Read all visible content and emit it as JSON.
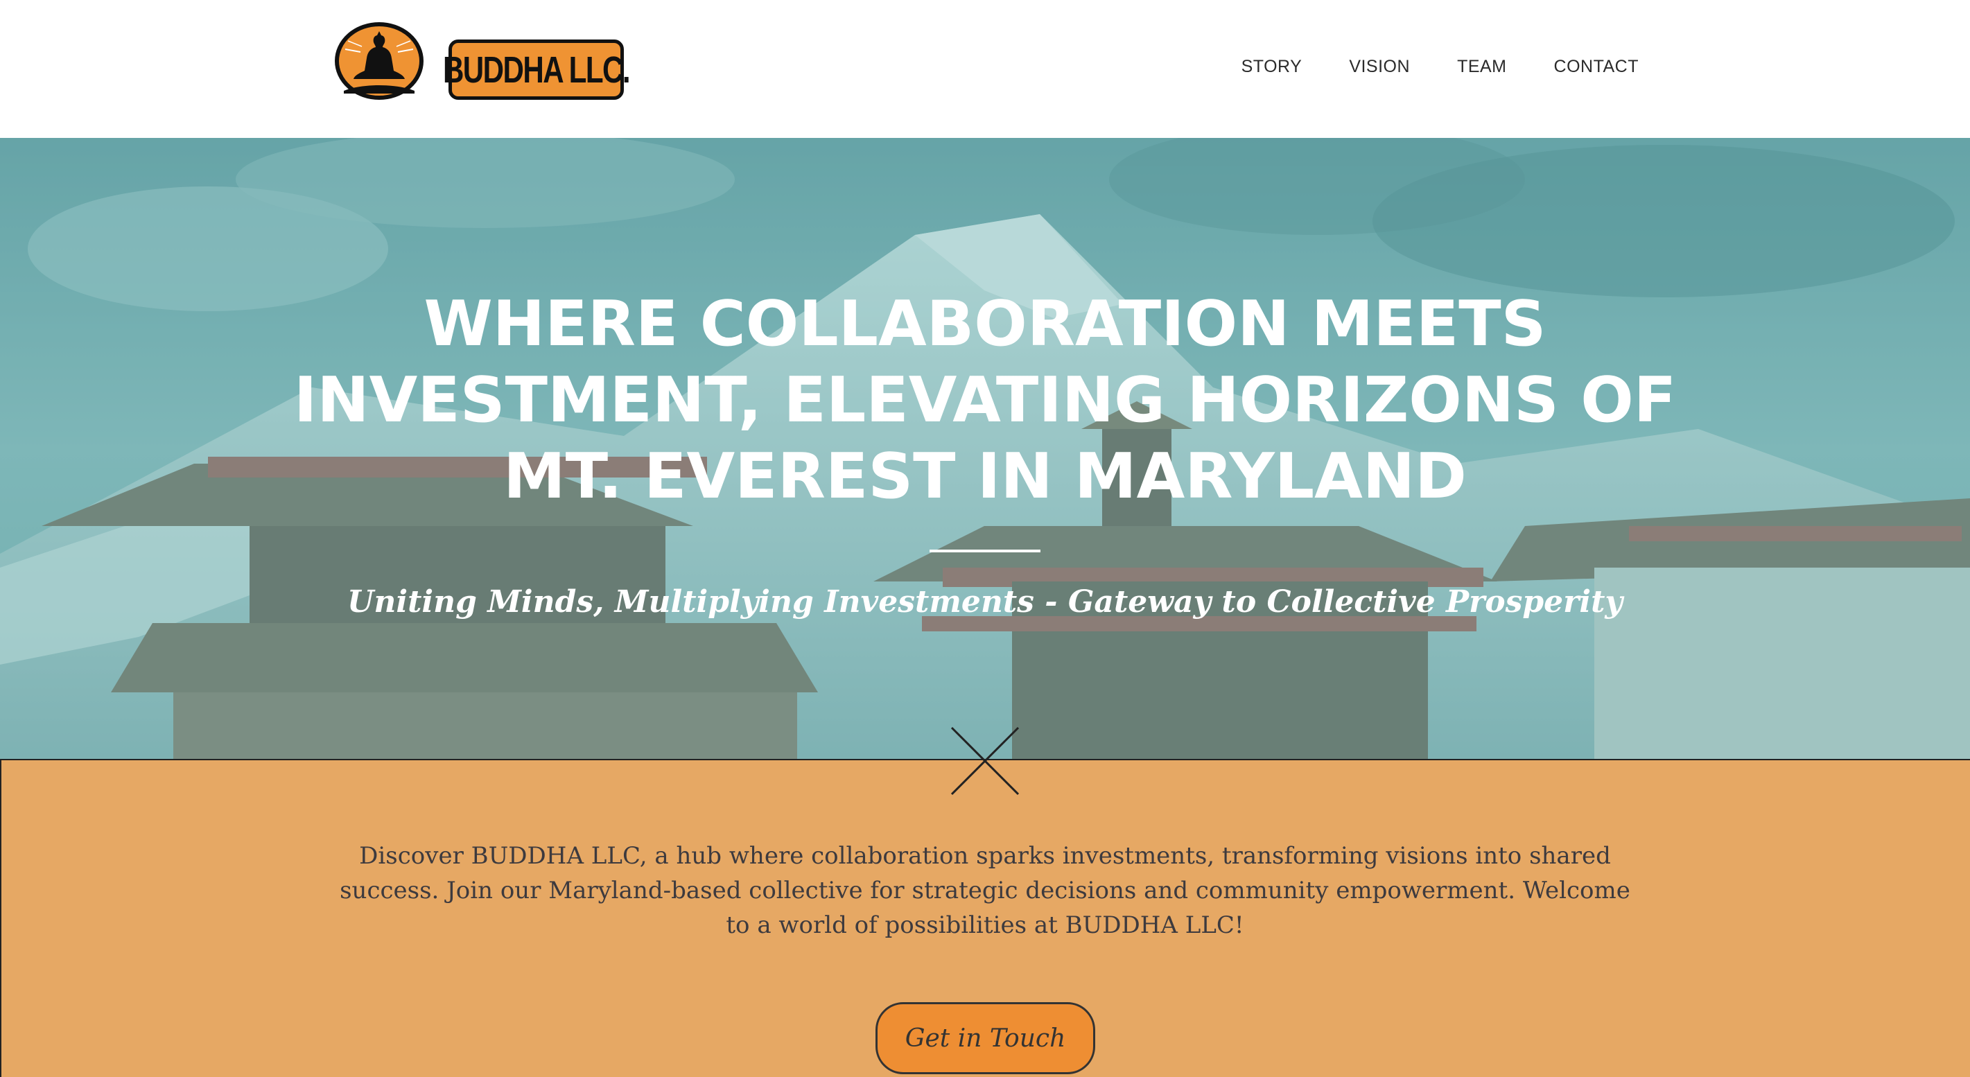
{
  "brand": {
    "logo_text": "BUDDHA LLC.",
    "emblem_icon": "buddha-silhouette-icon",
    "color_orange": "#ef9333"
  },
  "nav": {
    "items": [
      {
        "label": "STORY"
      },
      {
        "label": "VISION"
      },
      {
        "label": "TEAM"
      },
      {
        "label": "CONTACT"
      }
    ]
  },
  "hero": {
    "title": "WHERE COLLABORATION MEETS INVESTMENT, ELEVATING HORIZONS OF MT. EVEREST IN MARYLAND",
    "subtitle": "Uniting Minds, Multiplying Investments - Gateway to Collective Prosperity",
    "overlay_color": "#5fa6a6"
  },
  "about": {
    "text": "Discover BUDDHA LLC, a hub where collaboration sparks investments, transforming visions into shared success. Join our Maryland-based collective for strategic decisions and community empowerment. Welcome to a world of possibilities at BUDDHA LLC!",
    "cta_label": "Get in Touch",
    "close_icon": "close-icon",
    "background_color": "#e6a864"
  }
}
